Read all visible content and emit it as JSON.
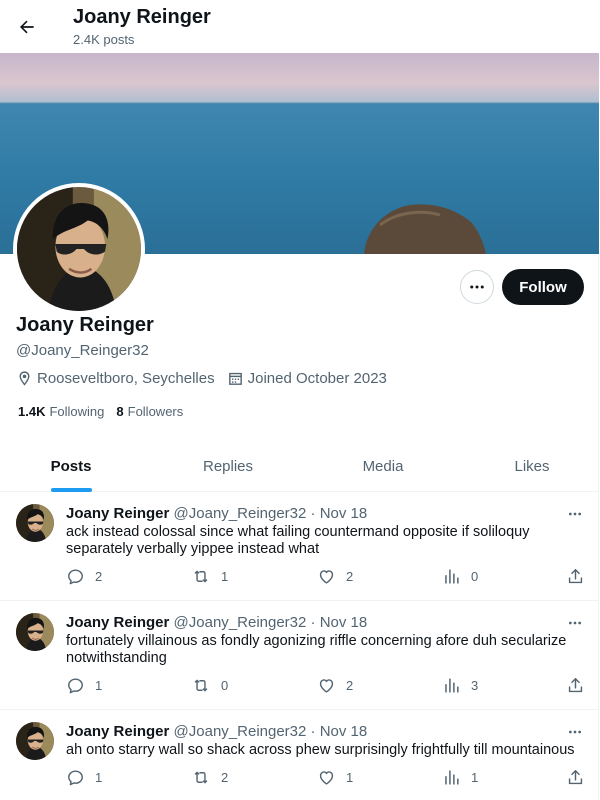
{
  "header": {
    "title": "Joany Reinger",
    "subtitle": "2.4K posts",
    "back_icon": "arrow-left-icon"
  },
  "profile": {
    "name": "Joany Reinger",
    "handle": "@Joany_Reinger32",
    "location": "Rooseveltboro, Seychelles",
    "joined": "Joined October 2023",
    "following_count": "1.4K",
    "following_label": "Following",
    "followers_count": "8",
    "followers_label": "Followers",
    "follow_label": "Follow",
    "more_icon": "ellipsis-icon",
    "location_icon": "location-pin-icon",
    "calendar_icon": "calendar-icon"
  },
  "tabs": [
    {
      "label": "Posts",
      "active": true
    },
    {
      "label": "Replies",
      "active": false
    },
    {
      "label": "Media",
      "active": false
    },
    {
      "label": "Likes",
      "active": false
    }
  ],
  "posts": [
    {
      "name": "Joany Reinger",
      "handle": "@Joany_Reinger32",
      "date": "· Nov 18",
      "text": "ack instead colossal since what failing countermand opposite if soliloquy separately verbally yippee instead what",
      "replies": "2",
      "reposts": "1",
      "likes": "2",
      "views": "0"
    },
    {
      "name": "Joany Reinger",
      "handle": "@Joany_Reinger32",
      "date": "· Nov 18",
      "text": "fortunately villainous as fondly agonizing riffle concerning afore duh secularize notwithstanding",
      "replies": "1",
      "reposts": "0",
      "likes": "2",
      "views": "3"
    },
    {
      "name": "Joany Reinger",
      "handle": "@Joany_Reinger32",
      "date": "· Nov 18",
      "text": "ah onto starry wall so shack across phew surprisingly frightfully till mountainous",
      "replies": "1",
      "reposts": "2",
      "likes": "1",
      "views": "1"
    }
  ],
  "colors": {
    "accent": "#1d9bf0",
    "text": "#0f1419",
    "secondary": "#536471",
    "follow_bg": "#0f1419"
  }
}
